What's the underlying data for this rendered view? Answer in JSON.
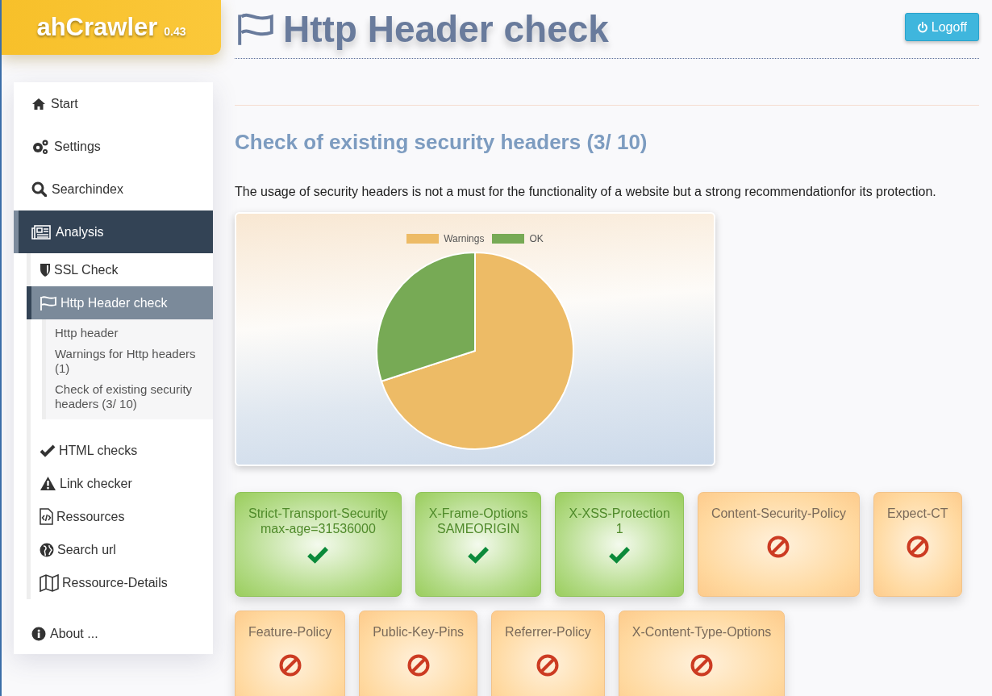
{
  "brand": {
    "name": "ahCrawler",
    "version": "0.43"
  },
  "page_title": "Http Header check",
  "logoff_button": "Logoff",
  "sidebar": {
    "items": [
      {
        "label": "Start",
        "selected": false
      },
      {
        "label": "Settings",
        "selected": false
      },
      {
        "label": "Searchindex",
        "selected": false
      },
      {
        "label": "Analysis",
        "selected": true,
        "children": [
          {
            "label": "SSL Check",
            "selected": false
          },
          {
            "label": "Http Header check",
            "selected": true,
            "children": [
              {
                "label": "Http header"
              },
              {
                "label": "Warnings for Http headers (1)"
              },
              {
                "label": "Check of existing security headers (3/ 10)"
              }
            ]
          },
          {
            "label": "HTML checks",
            "selected": false
          },
          {
            "label": "Link checker",
            "selected": false
          },
          {
            "label": "Ressources",
            "selected": false
          },
          {
            "label": "Search url",
            "selected": false
          },
          {
            "label": "Ressource-Details",
            "selected": false
          }
        ]
      }
    ],
    "footer_item": {
      "label": "About ..."
    }
  },
  "section": {
    "heading": "Check of existing security headers (3/ 10)",
    "description": "The usage of security headers is not a must for the functionality of a website but a strong recommendationfor its protection.",
    "legend": [
      {
        "label": "Warnings",
        "color": "#edbb66"
      },
      {
        "label": "OK",
        "color": "#77aa55"
      }
    ],
    "headers": [
      {
        "kind": "ok",
        "name": "Strict-Transport-Security",
        "value": "max-age=31536000"
      },
      {
        "kind": "ok",
        "name": "X-Frame-Options",
        "value": "SAMEORIGIN"
      },
      {
        "kind": "ok",
        "name": "X-XSS-Protection",
        "value": "1"
      },
      {
        "kind": "missing",
        "name": "Content-Security-Policy"
      },
      {
        "kind": "missing",
        "name": "Expect-CT"
      },
      {
        "kind": "missing",
        "name": "Feature-Policy"
      },
      {
        "kind": "missing",
        "name": "Public-Key-Pins"
      },
      {
        "kind": "missing",
        "name": "Referrer-Policy"
      },
      {
        "kind": "missing",
        "name": "X-Content-Type-Options"
      }
    ]
  }
}
